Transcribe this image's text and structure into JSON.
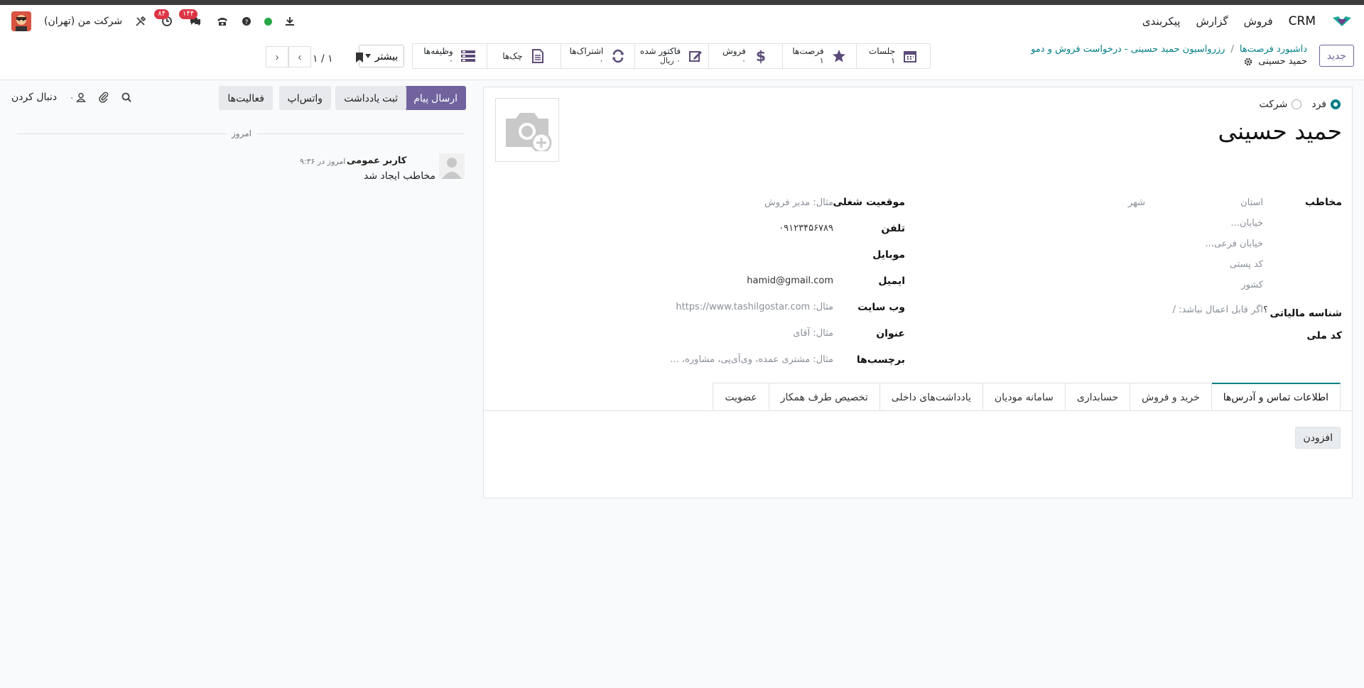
{
  "navbar": {
    "app_name": "CRM",
    "menus": [
      "فروش",
      "گزارش",
      "پیکربندی"
    ],
    "company": "شرکت من (تهران)",
    "chat_badge": "۱۴۴",
    "activity_badge": "۸۴"
  },
  "control": {
    "new_button": "جدید",
    "breadcrumb_1": "داشبورد فرصت‌ها",
    "breadcrumb_2": "رزرواسیون حمید حسینی - درخواست فروش و دمو",
    "current": "حمید حسینی",
    "more_button": "بیشتر",
    "pager": "۱ / ۱"
  },
  "stats": [
    {
      "label": "جلسات",
      "value": "۱",
      "icon": "calendar-icon"
    },
    {
      "label": "فرصت‌ها",
      "value": "۱",
      "icon": "star-icon"
    },
    {
      "label": "فروش",
      "value": "۰",
      "icon": "dollar-icon"
    },
    {
      "label": "فاکتور شده",
      "value": "۰ ریال",
      "icon": "pencil-icon"
    },
    {
      "label": "اشتراک‌ها",
      "value": "۰",
      "icon": "refresh-icon"
    },
    {
      "label": "چک‌ها",
      "value": "",
      "icon": "document-icon"
    },
    {
      "label": "وظیفه‌ها",
      "value": "۰",
      "icon": "tasks-icon"
    }
  ],
  "form": {
    "type_person": "فرد",
    "type_company": "شرکت",
    "name": "حمید حسینی",
    "address_label": "مخاطب",
    "state_ph": "استان",
    "city_ph": "شهر",
    "street_ph": "خیابان...",
    "street2_ph": "خیابان فرعی...",
    "zip_ph": "کد پستی",
    "country_ph": "کشور",
    "tax_label": "شناسه مالیاتی",
    "tax_help": "؟",
    "tax_ph": "اگر قابل اعمال نباشد: /",
    "national_label": "کد ملی",
    "job_label": "موقعیت شغلی",
    "job_ph": "مثال: مدیر فروش",
    "phone_label": "تلفن",
    "phone": "۰۹۱۲۳۴۵۶۷۸۹",
    "mobile_label": "موبایل",
    "email_label": "ایمیل",
    "email": "hamid@gmail.com",
    "website_label": "وب سایت",
    "website_ph": "مثال: https://www.tashilgostar.com",
    "title_label": "عنوان",
    "title_ph": "مثال: آقای",
    "tags_label": "برچسب‌ها",
    "tags_ph": "مثال: مشتری عمده، وی‌آی‌پی، مشاوره، ..."
  },
  "tabs": [
    "اطلاعات تماس و آدرس‌ها",
    "خرید و فروش",
    "حسابداری",
    "سامانه مودیان",
    "یادداشت‌های داخلی",
    "تخصیص طرف همکار",
    "عضویت"
  ],
  "add_button": "افزودن",
  "chatter": {
    "send": "ارسال پیام",
    "note": "ثبت یادداشت",
    "whatsapp": "واتس‌اپ",
    "activities": "فعالیت‌ها",
    "follow": "دنبال کردن",
    "followers": "۰",
    "day": "امروز",
    "author": "کاربر عمومی",
    "time": "امروز در ۹:۳۶",
    "body": "مخاطب ایجاد شد"
  }
}
